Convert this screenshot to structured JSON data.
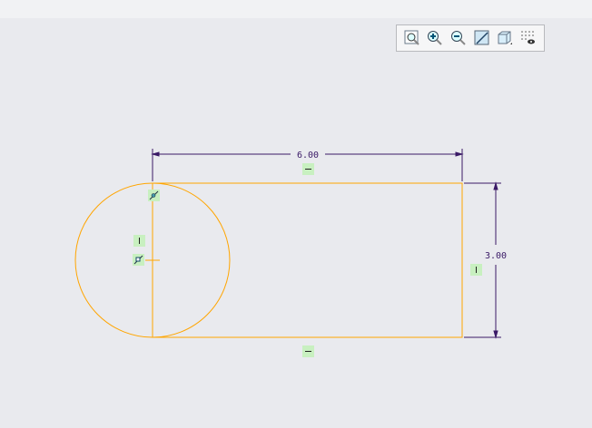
{
  "toolbar": {
    "items": [
      "refit-icon",
      "zoom-in-icon",
      "zoom-out-icon",
      "repaint-icon",
      "display-style-icon",
      "sketch-display-filter-icon"
    ]
  },
  "dimensions": {
    "width": "6.00",
    "height": "3.00"
  },
  "colors": {
    "geometry": "#ffa500",
    "dimension": "#3a1a66",
    "constraint_bg": "#c8f0c0"
  }
}
